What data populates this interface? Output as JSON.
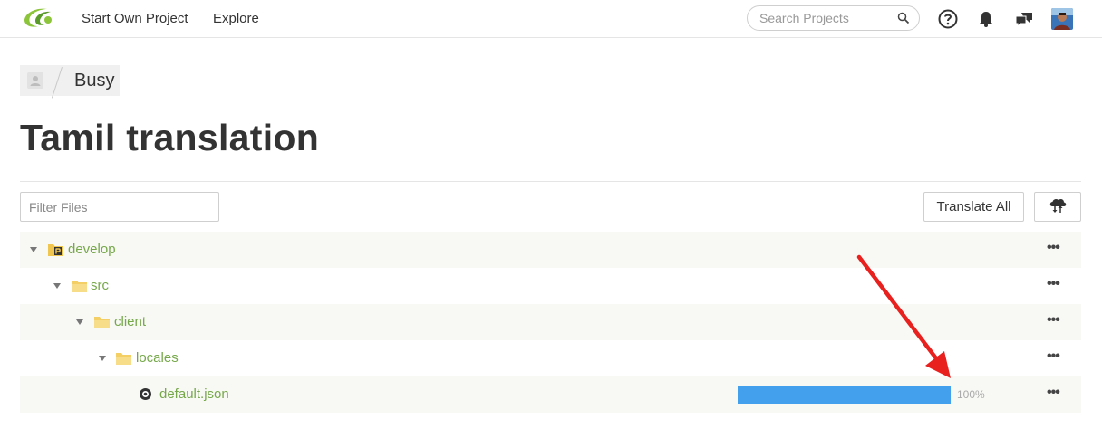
{
  "nav": {
    "start_project": "Start Own Project",
    "explore": "Explore",
    "search_placeholder": "Search Projects"
  },
  "breadcrumb": {
    "label": "Busy"
  },
  "page": {
    "title": "Tamil translation"
  },
  "toolbar": {
    "filter_placeholder": "Filter Files",
    "translate_all": "Translate All"
  },
  "tree": [
    {
      "name": "develop",
      "type": "branch",
      "depth": 0
    },
    {
      "name": "src",
      "type": "folder",
      "depth": 1
    },
    {
      "name": "client",
      "type": "folder",
      "depth": 2
    },
    {
      "name": "locales",
      "type": "folder",
      "depth": 3
    },
    {
      "name": "default.json",
      "type": "file",
      "depth": 4,
      "progress": 100,
      "progress_label": "100%"
    }
  ],
  "colors": {
    "link": "#76a84a",
    "progress": "#42a0ed",
    "annotation_arrow": "#e8201e"
  }
}
